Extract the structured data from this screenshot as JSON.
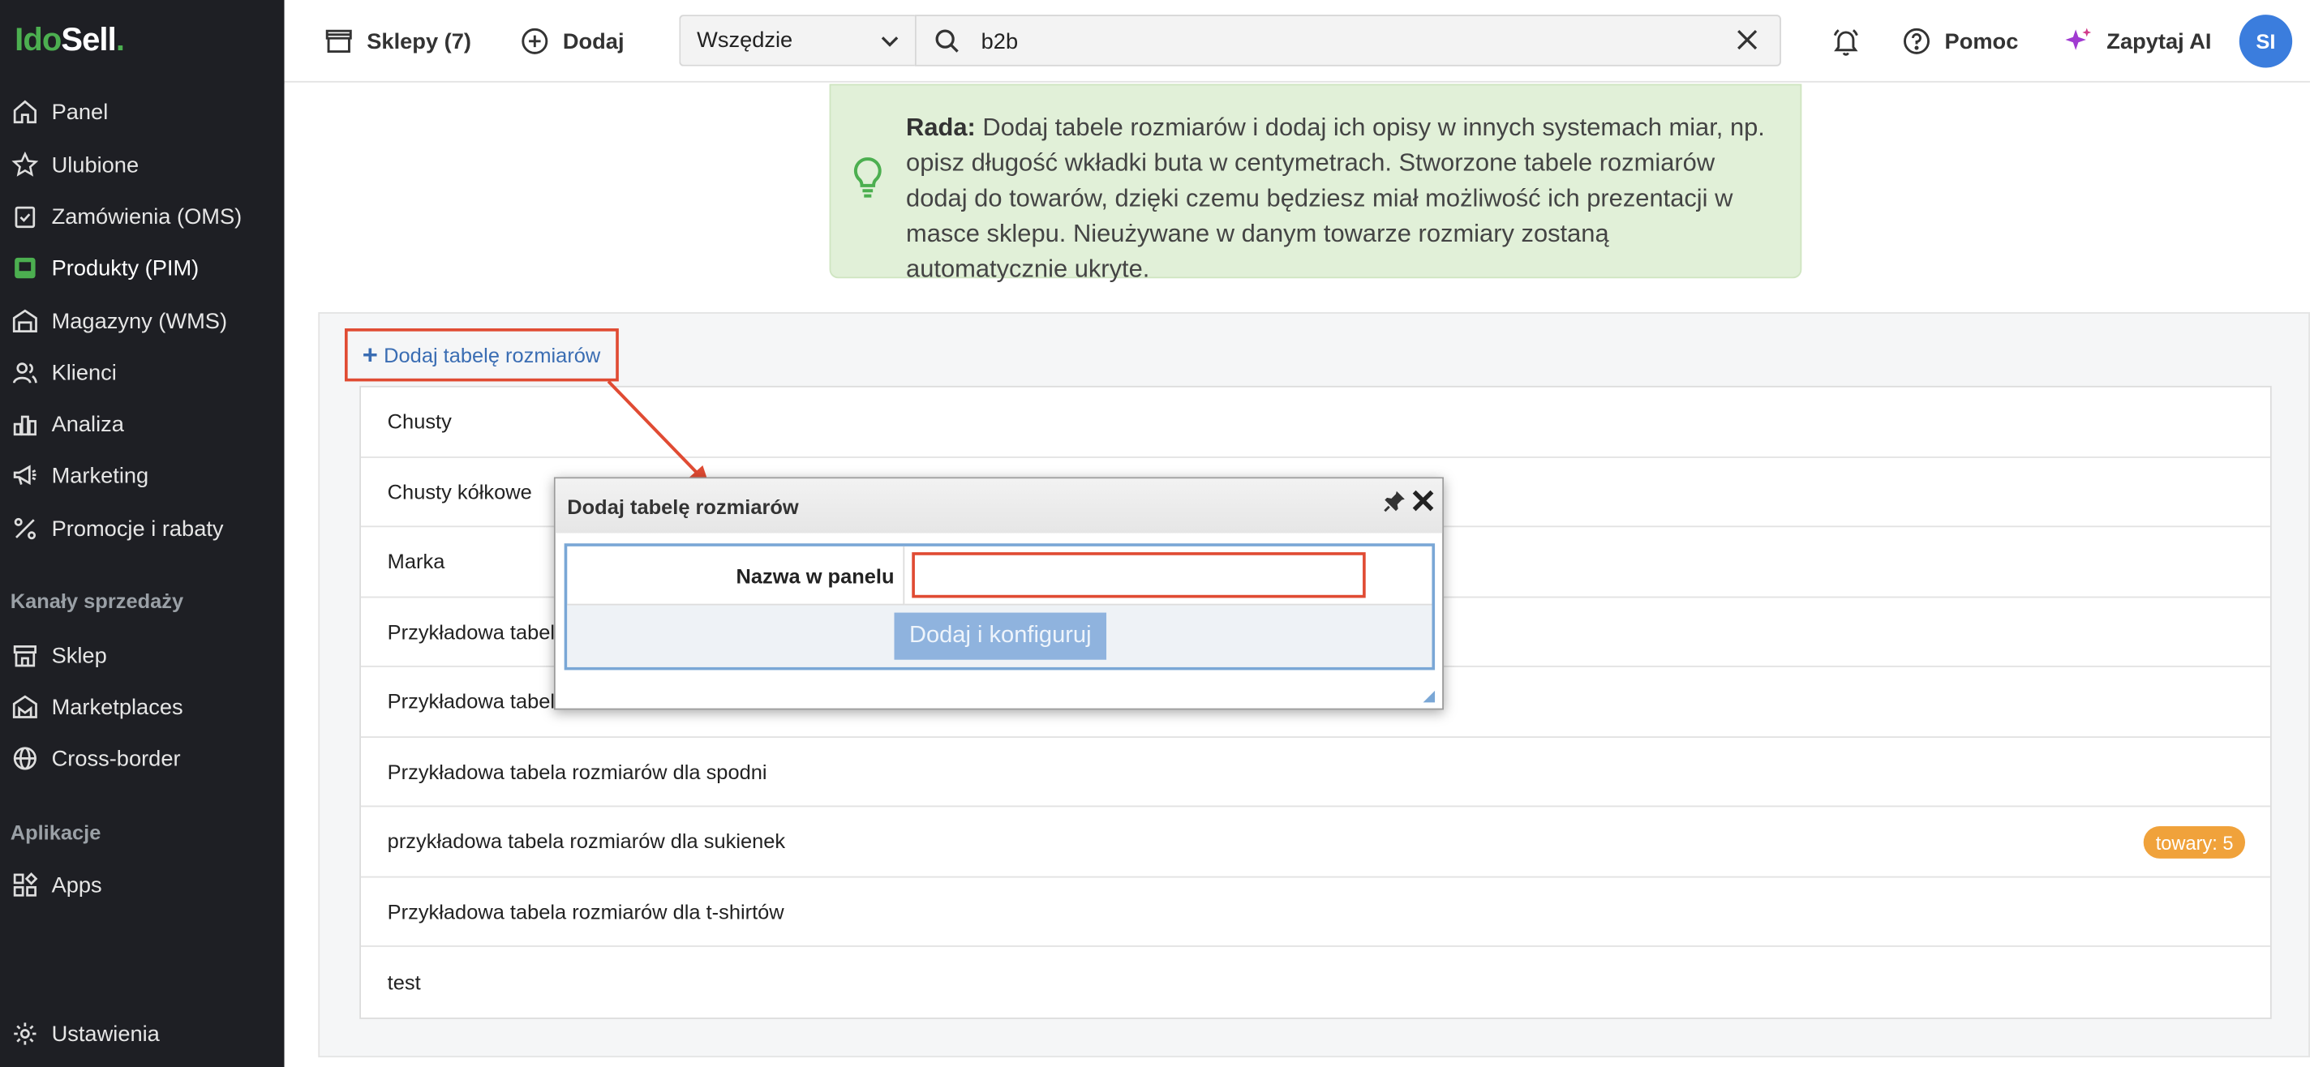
{
  "brand": {
    "logo_part1": "Ido",
    "logo_part2": "Sell",
    "logo_dot": ".",
    "accent_color": "#4caf50"
  },
  "sidebar": {
    "items": [
      {
        "label": "Panel",
        "icon": "home-icon"
      },
      {
        "label": "Ulubione",
        "icon": "star-icon"
      },
      {
        "label": "Zamówienia (OMS)",
        "icon": "clipboard-check-icon"
      },
      {
        "label": "Produkty (PIM)",
        "icon": "product-icon",
        "active": true
      },
      {
        "label": "Magazyny (WMS)",
        "icon": "warehouse-icon"
      },
      {
        "label": "Klienci",
        "icon": "users-icon"
      },
      {
        "label": "Analiza",
        "icon": "chart-icon"
      },
      {
        "label": "Marketing",
        "icon": "megaphone-icon"
      },
      {
        "label": "Promocje i rabaty",
        "icon": "percent-icon"
      }
    ],
    "section_sales": "Kanały sprzedaży",
    "sales_items": [
      {
        "label": "Sklep",
        "icon": "store-icon"
      },
      {
        "label": "Marketplaces",
        "icon": "marketplace-icon"
      },
      {
        "label": "Cross-border",
        "icon": "globe-icon"
      }
    ],
    "section_apps": "Aplikacje",
    "apps_items": [
      {
        "label": "Apps",
        "icon": "apps-icon"
      }
    ],
    "settings_label": "Ustawienia"
  },
  "topbar": {
    "shops_label": "Sklepy (7)",
    "add_label": "Dodaj",
    "scope_value": "Wszędzie",
    "search_value": "b2b",
    "help_label": "Pomoc",
    "ai_label": "Zapytaj AI",
    "avatar_initials": "SI"
  },
  "tip": {
    "prefix": "Rada:",
    "text": " Dodaj tabele rozmiarów i dodaj ich opisy w innych systemach miar, np. opisz długość wkładki buta w centymetrach. Stworzone tabele rozmiarów dodaj do towarów, dzięki czemu będziesz miał możliwość ich prezentacji w masce sklepu. Nieużywane w danym towarze rozmiary zostaną automatycznie ukryte."
  },
  "size_tables": {
    "add_label": "Dodaj tabelę rozmiarów",
    "rows": [
      "Chusty",
      "Chusty kółkowe",
      "Marka",
      "Przykładowa tabela",
      "Przykładowa tabela",
      "Przykładowa tabela rozmiarów dla spodni",
      "przykładowa tabela rozmiarów dla sukienek",
      "Przykładowa tabela rozmiarów dla t-shirtów",
      "test"
    ],
    "badge_text": "towary: 5",
    "badge_color": "#f0a23b"
  },
  "dialog": {
    "title": "Dodaj tabelę rozmiarów",
    "name_label": "Nazwa w panelu",
    "name_value": "",
    "submit_label": "Dodaj i konfiguruj"
  },
  "annotation_color": "#e04b33"
}
